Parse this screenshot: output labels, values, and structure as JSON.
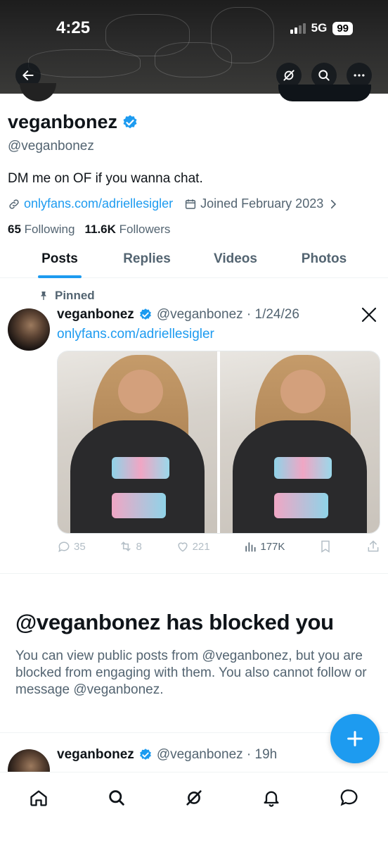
{
  "status_bar": {
    "time": "4:25",
    "network": "5G",
    "battery": "99"
  },
  "profile": {
    "display_name": "veganbonez",
    "handle": "@veganbonez",
    "bio": "DM me on OF if you wanna chat.",
    "link": "onlyfans.com/adriellesigler",
    "joined": "Joined February 2023",
    "following_count": "65",
    "following_label": "Following",
    "followers_count": "11.6K",
    "followers_label": "Followers"
  },
  "tabs": [
    {
      "label": "Posts",
      "active": true
    },
    {
      "label": "Replies",
      "active": false
    },
    {
      "label": "Videos",
      "active": false
    },
    {
      "label": "Photos",
      "active": false
    }
  ],
  "pinned_post": {
    "pinned_label": "Pinned",
    "name": "veganbonez",
    "handle_date": "@veganbonez · 1/24/26",
    "link": "onlyfans.com/adriellesigler",
    "replies": "35",
    "reposts": "8",
    "likes": "221",
    "views": "177K"
  },
  "blocked": {
    "title": "@veganbonez has blocked you",
    "text": "You can view public posts from @veganbonez, but you are blocked from engaging with them. You also cannot follow or message @veganbonez."
  },
  "next_post": {
    "name": "veganbonez",
    "handle_time": "@veganbonez · 19h"
  },
  "colors": {
    "accent": "#1d9bf0",
    "text": "#0f1419",
    "muted": "#536471"
  },
  "icons": [
    "back-arrow-icon",
    "grok-icon",
    "search-icon",
    "more-icon",
    "verified-icon",
    "link-icon",
    "calendar-icon",
    "chevron-right-icon",
    "pin-icon",
    "x-logo-icon",
    "reply-icon",
    "repost-icon",
    "like-icon",
    "views-icon",
    "bookmark-icon",
    "share-icon",
    "plus-icon",
    "home-icon",
    "notifications-icon",
    "messages-icon"
  ]
}
